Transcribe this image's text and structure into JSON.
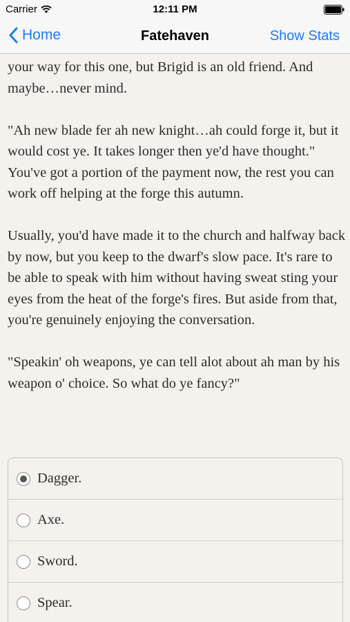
{
  "status": {
    "carrier": "Carrier",
    "time": "12:11 PM"
  },
  "nav": {
    "back_label": "Home",
    "title": "Fatehaven",
    "right_label": "Show Stats"
  },
  "story": {
    "paragraphs": [
      "your way for this one, but Brigid is an old friend. And maybe…never mind.",
      "\"Ah new blade fer ah new knight…ah could forge it, but it would cost ye. It takes longer then ye'd have thought.\" You've got a portion of the payment now, the rest you can work off helping at the forge this autumn.",
      "Usually, you'd have made it to the church and halfway back by now, but you keep to the dwarf's slow pace. It's rare to be able to speak with him without having sweat sting your eyes from the heat of the forge's fires. But aside from that, you're genuinely enjoying the conversation.",
      "\"Speakin' oh weapons, ye can tell alot about ah man by his weapon o' choice. So what do ye fancy?\""
    ]
  },
  "choices": [
    {
      "label": "Dagger.",
      "selected": true
    },
    {
      "label": "Axe.",
      "selected": false
    },
    {
      "label": "Sword.",
      "selected": false
    },
    {
      "label": "Spear.",
      "selected": false
    }
  ],
  "colors": {
    "accent": "#1a7cf5",
    "background": "#f5f2ee"
  }
}
